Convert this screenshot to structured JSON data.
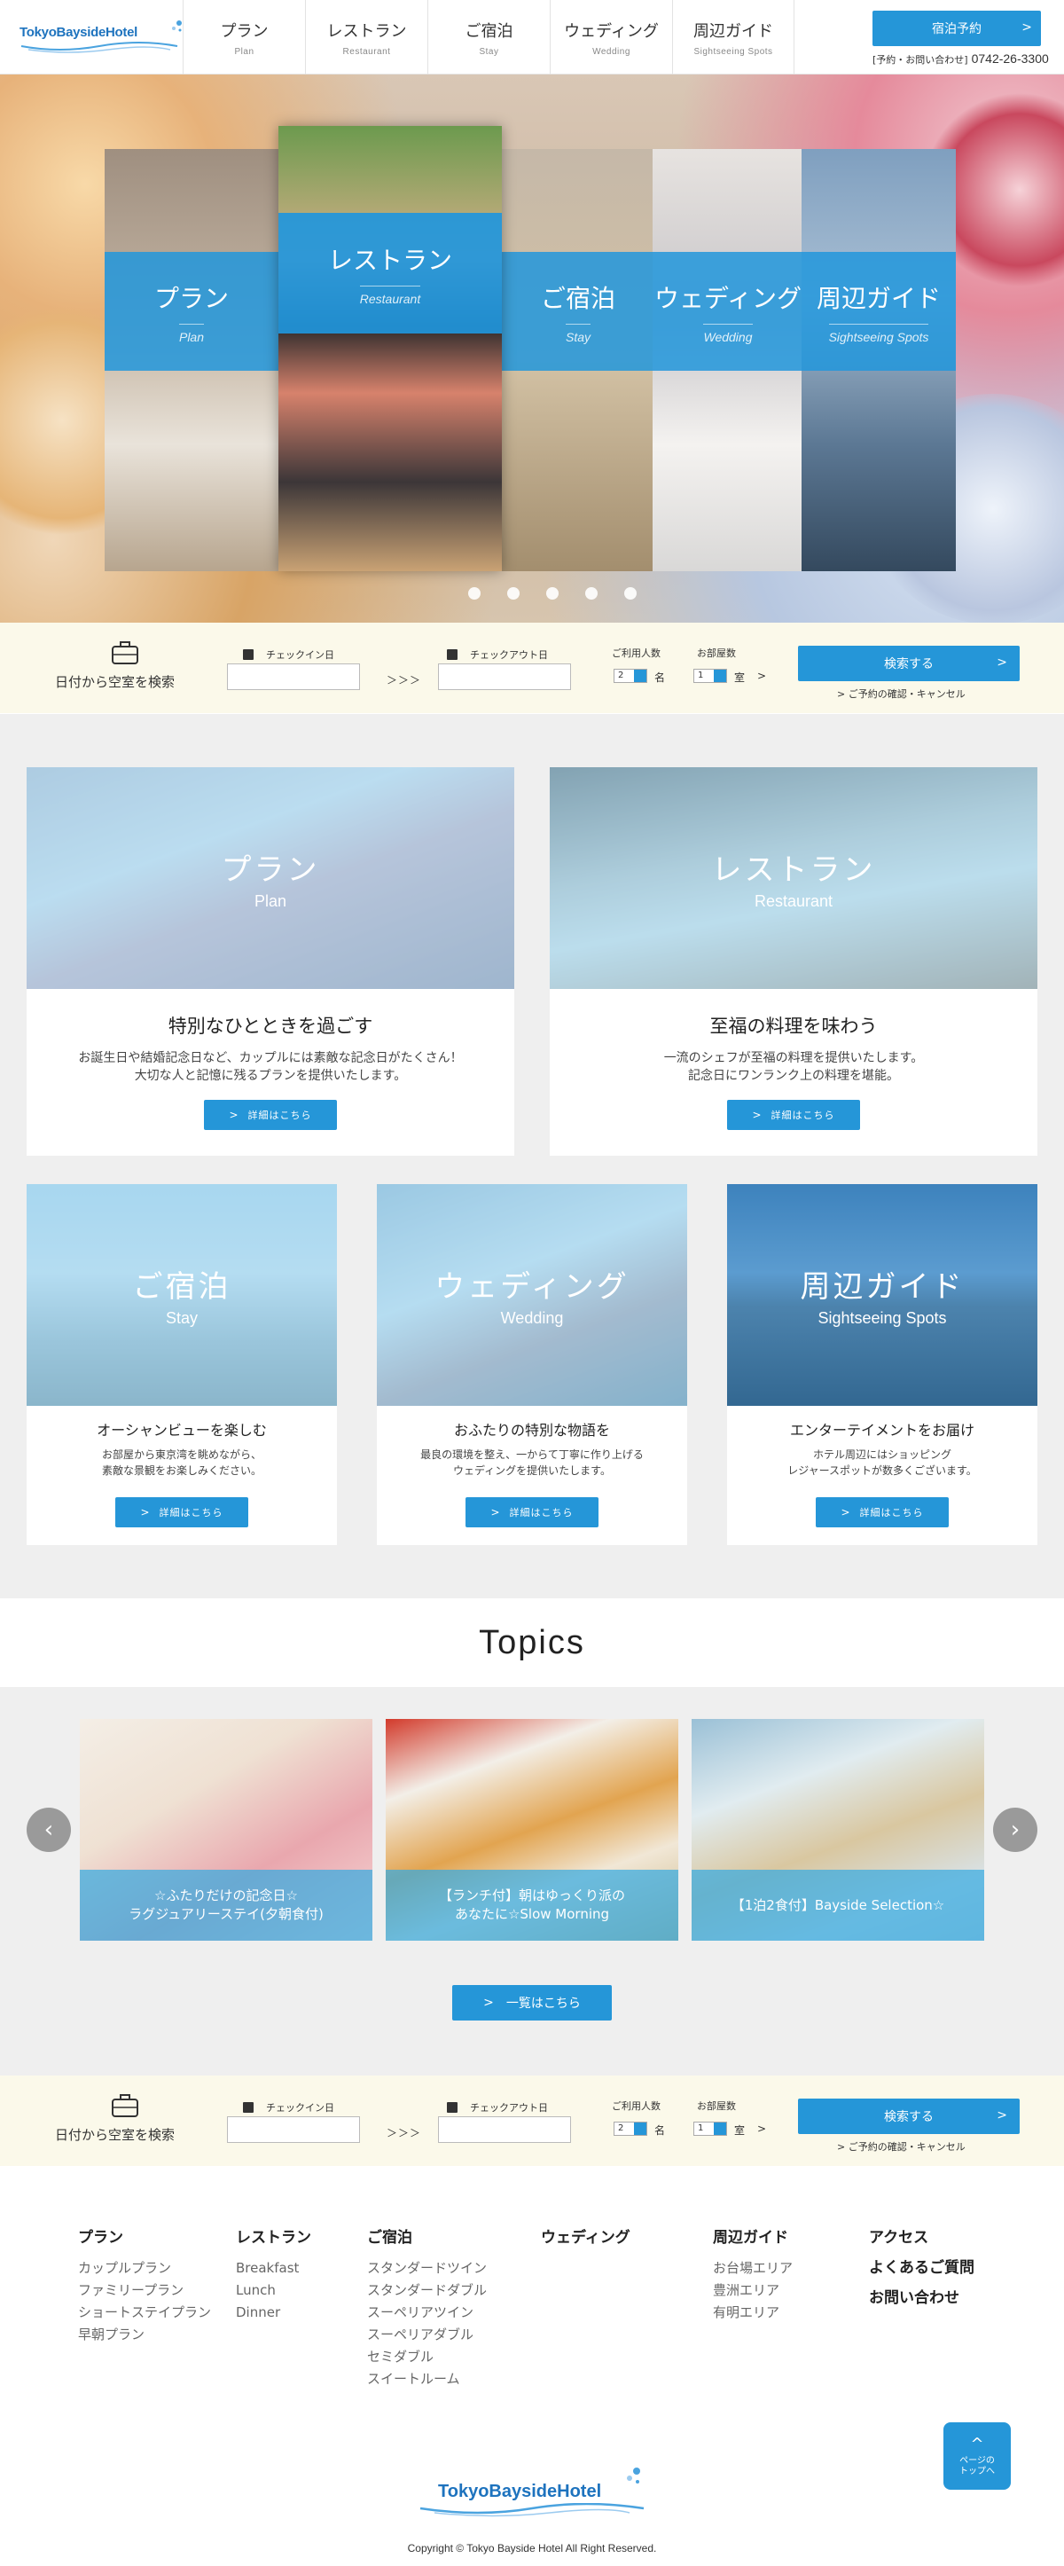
{
  "header": {
    "logo": "TokyoBaysideHotel",
    "nav": [
      {
        "jp": "プラン",
        "en": "Plan"
      },
      {
        "jp": "レストラン",
        "en": "Restaurant"
      },
      {
        "jp": "ご宿泊",
        "en": "Stay"
      },
      {
        "jp": "ウェディング",
        "en": "Wedding"
      },
      {
        "jp": "周辺ガイド",
        "en": "Sightseeing Spots"
      }
    ],
    "reserve_label": "宿泊予約",
    "contact_label": "[予約・お問い合わせ]",
    "contact_tel": "0742-26-3300"
  },
  "hero": {
    "panels": [
      {
        "title": "プラン",
        "sub": "Plan"
      },
      {
        "title": "レストラン",
        "sub": "Restaurant"
      },
      {
        "title": "ご宿泊",
        "sub": "Stay"
      },
      {
        "title": "ウェディング",
        "sub": "Wedding"
      },
      {
        "title": "周辺ガイド",
        "sub": "Sightseeing Spots"
      }
    ],
    "active_slide": 2,
    "slide_count": 5
  },
  "search": {
    "label": "日付から空室を検索",
    "checkin_label": "チェックイン日",
    "checkout_label": "チェックアウト日",
    "arrows": "＞＞＞",
    "guests_label": "ご利用人数",
    "guests_value": "2",
    "guests_unit": "名",
    "rooms_label": "お部屋数",
    "rooms_value": "1",
    "rooms_unit": "室",
    "submit_label": "検索する",
    "confirm_label": "ご予約の確認・キャンセル"
  },
  "cards": [
    {
      "overlay_jp": "プラン",
      "overlay_en": "Plan",
      "title": "特別なひとときを過ごす",
      "desc": "お誕生日や結婚記念日など、カップルには素敵な記念日がたくさん！\n大切な人と記憶に残るプランを提供いたします。",
      "more": "詳細はこちら"
    },
    {
      "overlay_jp": "レストラン",
      "overlay_en": "Restaurant",
      "title": "至福の料理を味わう",
      "desc": "一流のシェフが至福の料理を提供いたします。\n記念日にワンランク上の料理を堪能。",
      "more": "詳細はこちら"
    },
    {
      "overlay_jp": "ご宿泊",
      "overlay_en": "Stay",
      "title": "オーシャンビューを楽しむ",
      "desc": "お部屋から東京湾を眺めながら、\n素敵な景観をお楽しみください。",
      "more": "詳細はこちら"
    },
    {
      "overlay_jp": "ウェディング",
      "overlay_en": "Wedding",
      "title": "おふたりの特別な物語を",
      "desc": "最良の環境を整え、一からて丁寧に作り上げる\nウェディングを提供いたします。",
      "more": "詳細はこちら"
    },
    {
      "overlay_jp": "周辺ガイド",
      "overlay_en": "Sightseeing Spots",
      "title": "エンターテイメントをお届け",
      "desc": "ホテル周辺にはショッピング\nレジャースポットが数多くございます。",
      "more": "詳細はこちら"
    }
  ],
  "topics": {
    "title": "Topics",
    "items": [
      {
        "caption": "☆ふたりだけの記念日☆\nラグジュアリーステイ(夕朝食付)"
      },
      {
        "caption": "【ランチ付】朝はゆっくり派の\nあなたに☆Slow Morning"
      },
      {
        "caption": "【1泊2食付】Bayside Selection☆"
      }
    ],
    "prev": "‹",
    "next": "›",
    "list_label": "一覧はこちら"
  },
  "footer": {
    "columns": [
      {
        "head": "プラン",
        "items": [
          "カップルプラン",
          "ファミリープラン",
          "ショートステイプラン",
          "早朝プラン"
        ]
      },
      {
        "head": "レストラン",
        "items": [
          "Breakfast",
          "Lunch",
          "Dinner"
        ]
      },
      {
        "head": "ご宿泊",
        "items": [
          "スタンダードツイン",
          "スタンダードダブル",
          "スーペリアツイン",
          "スーペリアダブル",
          "セミダブル",
          "スイートルーム"
        ]
      },
      {
        "head": "ウェディング",
        "items": []
      },
      {
        "head": "周辺ガイド",
        "items": [
          "お台場エリア",
          "豊洲エリア",
          "有明エリア"
        ]
      }
    ],
    "links": [
      "アクセス",
      "よくあるご質問",
      "お問い合わせ"
    ],
    "pagetop": "ページの\nトップへ",
    "logo": "TokyoBaysideHotel",
    "copyright": "Copyright © Tokyo Bayside Hotel All Right Reserved."
  }
}
